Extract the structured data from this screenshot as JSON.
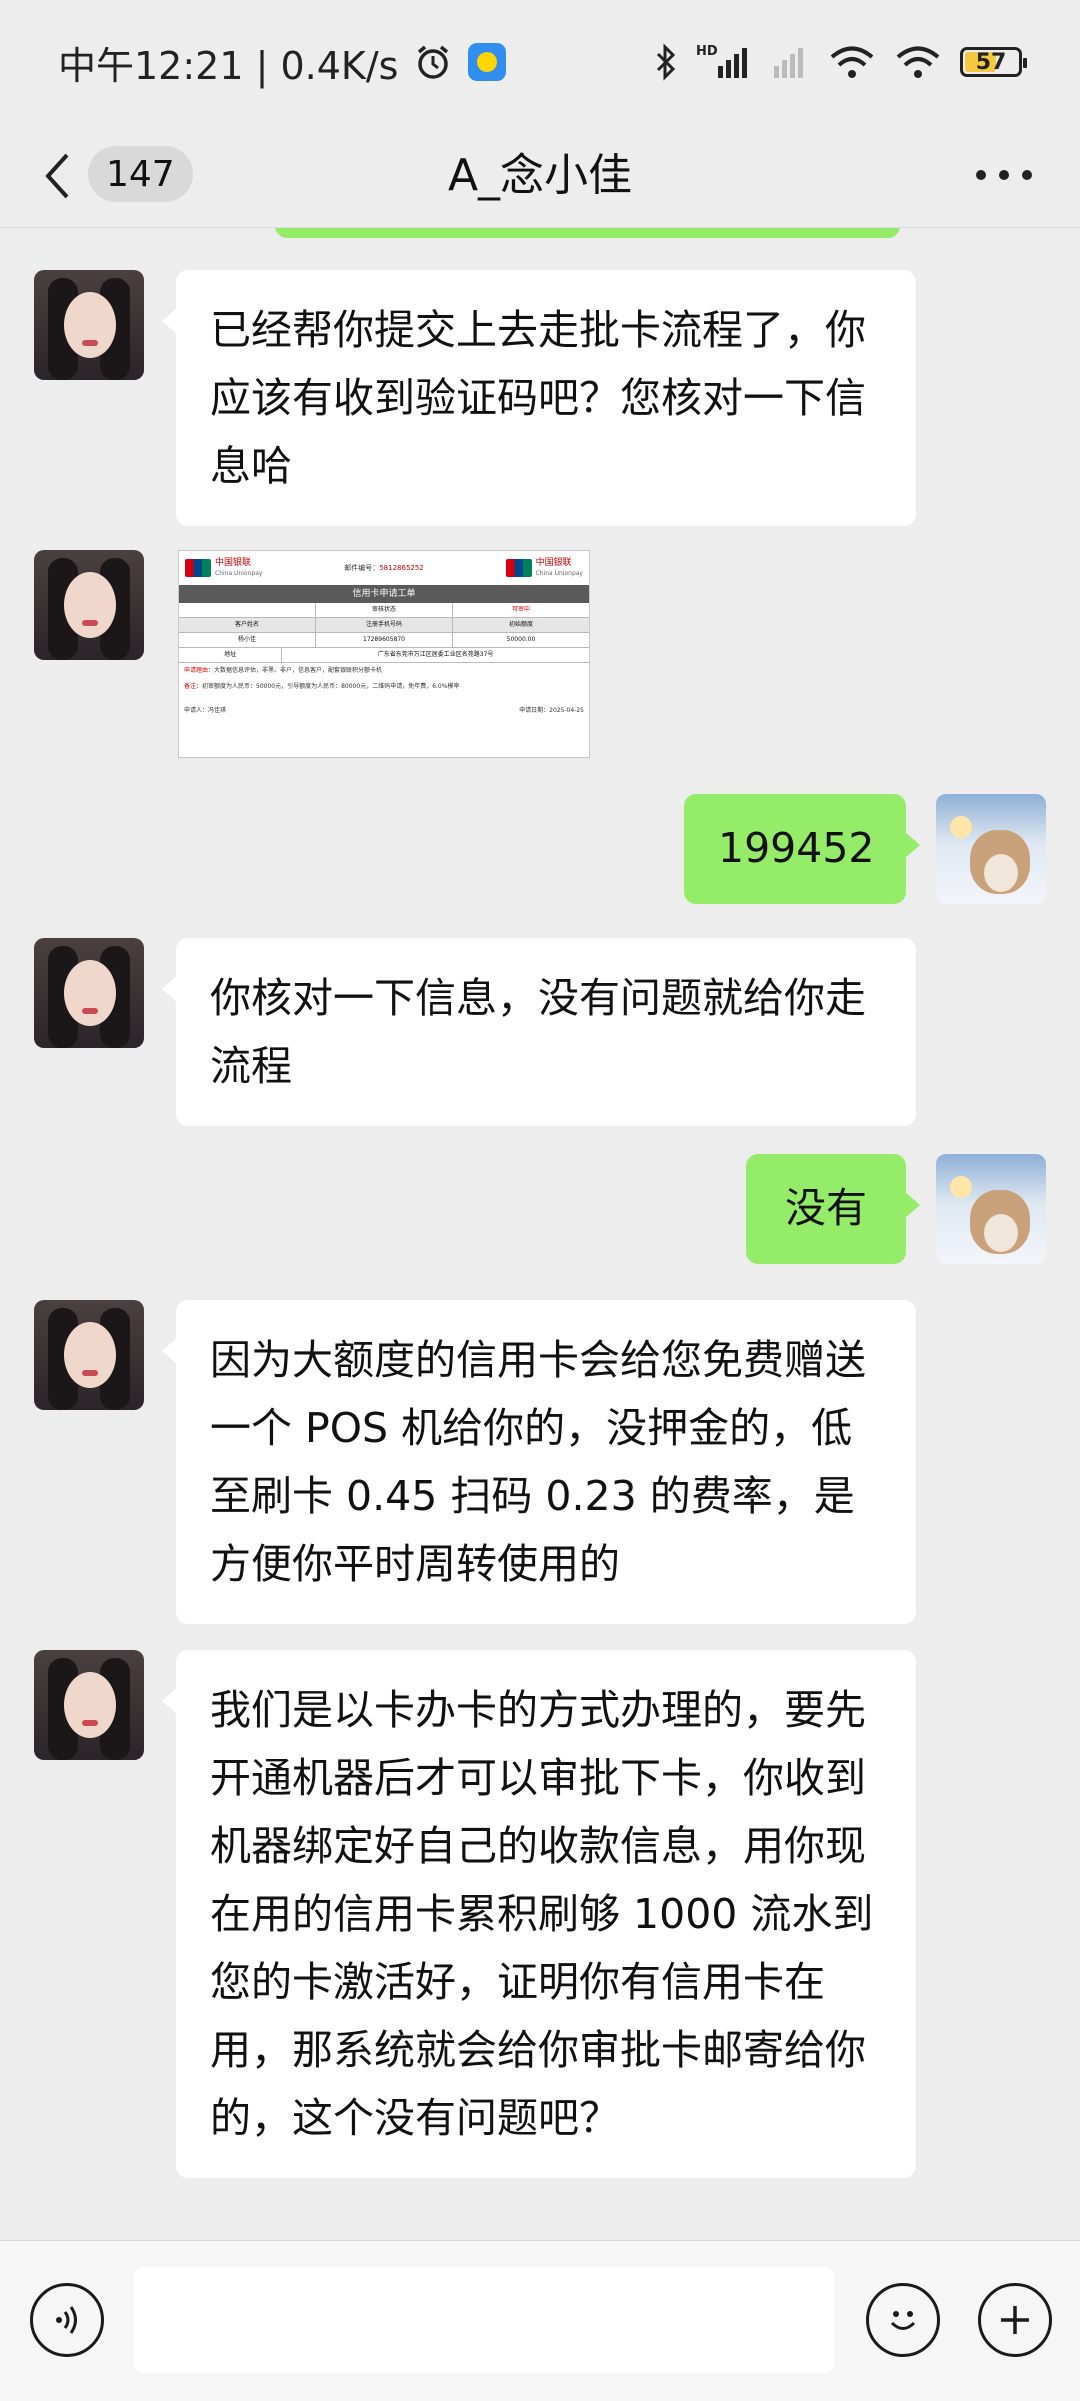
{
  "status_bar": {
    "time_text": "中午12:21 | 0.4K/s",
    "battery_level": "57"
  },
  "header": {
    "back_count": "147",
    "title": "A_念小佳"
  },
  "messages": {
    "m1": "已经帮你提交上去走批卡流程了，你应该有收到验证码吧？您核对一下信息哈",
    "m2": "199452",
    "m3": "你核对一下信息，没有问题就给你走流程",
    "m4": "没有",
    "m5": "因为大额度的信用卡会给您免费赠送一个 POS 机给你的，没押金的，低至刷卡 0.45 扫码 0.23 的费率，是方便你平时周转使用的",
    "m6": "我们是以卡办卡的方式办理的，要先开通机器后才可以审批下卡，你收到机器绑定好自己的收款信息，用你现在用的信用卡累积刷够 1000 流水到您的卡激活好，证明你有信用卡在用，那系统就会给你审批卡邮寄给你的，这个没有问题吧？"
  },
  "image_form": {
    "brand_cn": "中国银联",
    "brand_en": "China Unionpay",
    "order_label": "邮件编号：",
    "order_no": "5812865252",
    "title": "信用卡申请工单",
    "status_label": "审核状态",
    "status_value": "可审中",
    "col_name": "客户姓名",
    "col_phone": "注册手机号码",
    "col_limit": "初始额度",
    "name": "杨小佳",
    "phone": "17289605870",
    "limit": "50000.00",
    "addr_label": "地址",
    "addr": "广东省东莞市万江区居委工业区名苑路37号",
    "note1_label": "申请理由：",
    "note1": "大数据信息评估，非黑、非户，信息客户，配套银联积分额卡机",
    "note2_label": "备注：",
    "note2": "初审额度为人民币：50000元，引导额度为人民币：80000元，二维码申请，免年费，6.0%模率",
    "applicant": "申请人：冯佳琪",
    "date": "申请日期：2025-04-25"
  },
  "input": {
    "placeholder": ""
  },
  "colors": {
    "background": "#ededed",
    "incoming_bubble": "#ffffff",
    "outgoing_bubble": "#95ec69",
    "battery_fill": "#f5c842"
  },
  "icons": [
    "chevron-left-icon",
    "more-icon",
    "voice-icon",
    "emoji-icon",
    "plus-icon",
    "bluetooth-icon",
    "signal-icon",
    "wifi-icon",
    "alarm-icon",
    "battery-icon"
  ]
}
